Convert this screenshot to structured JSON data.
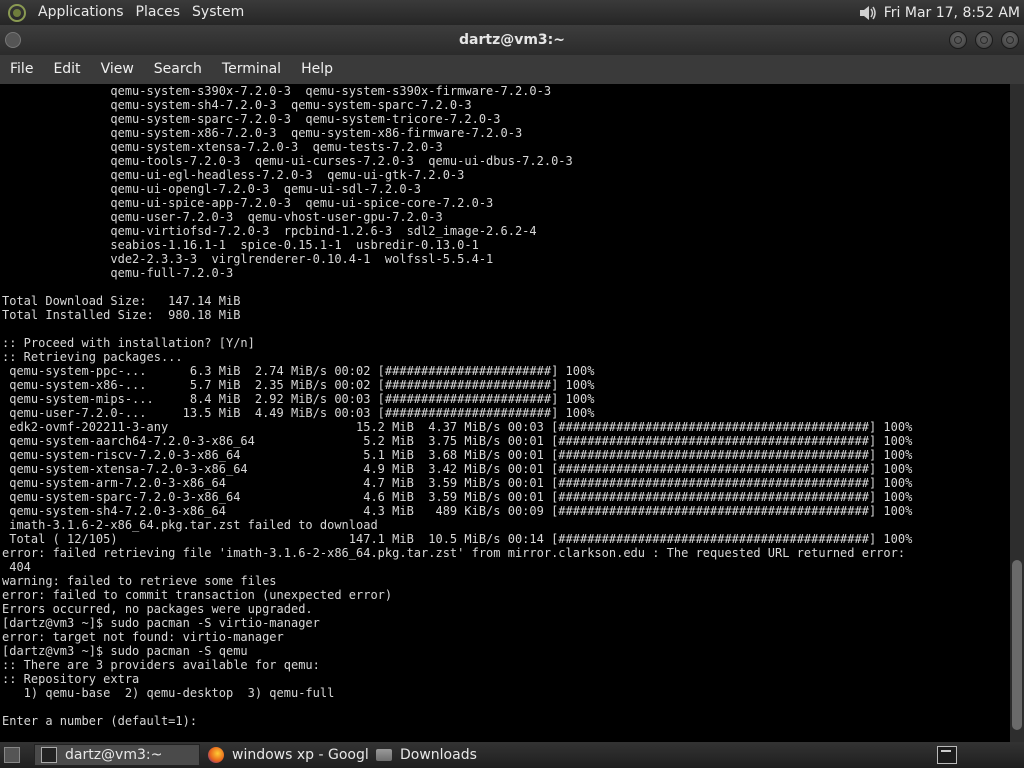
{
  "top_panel": {
    "menus": [
      "Applications",
      "Places",
      "System"
    ],
    "clock": "Fri Mar 17,  8:52 AM",
    "icons": {
      "logo": "distro-logo-icon",
      "volume": "speaker-volume-icon"
    }
  },
  "window": {
    "title": "dartz@vm3:~"
  },
  "menubar": [
    "File",
    "Edit",
    "View",
    "Search",
    "Terminal",
    "Help"
  ],
  "terminal": {
    "lines": [
      "               qemu-system-s390x-7.2.0-3  qemu-system-s390x-firmware-7.2.0-3",
      "               qemu-system-sh4-7.2.0-3  qemu-system-sparc-7.2.0-3",
      "               qemu-system-sparc-7.2.0-3  qemu-system-tricore-7.2.0-3",
      "               qemu-system-x86-7.2.0-3  qemu-system-x86-firmware-7.2.0-3",
      "               qemu-system-xtensa-7.2.0-3  qemu-tests-7.2.0-3",
      "               qemu-tools-7.2.0-3  qemu-ui-curses-7.2.0-3  qemu-ui-dbus-7.2.0-3",
      "               qemu-ui-egl-headless-7.2.0-3  qemu-ui-gtk-7.2.0-3",
      "               qemu-ui-opengl-7.2.0-3  qemu-ui-sdl-7.2.0-3",
      "               qemu-ui-spice-app-7.2.0-3  qemu-ui-spice-core-7.2.0-3",
      "               qemu-user-7.2.0-3  qemu-vhost-user-gpu-7.2.0-3",
      "               qemu-virtiofsd-7.2.0-3  rpcbind-1.2.6-3  sdl2_image-2.6.2-4",
      "               seabios-1.16.1-1  spice-0.15.1-1  usbredir-0.13.0-1",
      "               vde2-2.3.3-3  virglrenderer-0.10.4-1  wolfssl-5.5.4-1",
      "               qemu-full-7.2.0-3",
      "",
      "Total Download Size:   147.14 MiB",
      "Total Installed Size:  980.18 MiB",
      "",
      ":: Proceed with installation? [Y/n]",
      ":: Retrieving packages...",
      " qemu-system-ppc-...      6.3 MiB  2.74 MiB/s 00:02 [#######################] 100%",
      " qemu-system-x86-...      5.7 MiB  2.35 MiB/s 00:02 [#######################] 100%",
      " qemu-system-mips-...     8.4 MiB  2.92 MiB/s 00:03 [#######################] 100%",
      " qemu-user-7.2.0-...     13.5 MiB  4.49 MiB/s 00:03 [#######################] 100%",
      " edk2-ovmf-202211-3-any                          15.2 MiB  4.37 MiB/s 00:03 [###########################################] 100%",
      " qemu-system-aarch64-7.2.0-3-x86_64               5.2 MiB  3.75 MiB/s 00:01 [###########################################] 100%",
      " qemu-system-riscv-7.2.0-3-x86_64                 5.1 MiB  3.68 MiB/s 00:01 [###########################################] 100%",
      " qemu-system-xtensa-7.2.0-3-x86_64                4.9 MiB  3.42 MiB/s 00:01 [###########################################] 100%",
      " qemu-system-arm-7.2.0-3-x86_64                   4.7 MiB  3.59 MiB/s 00:01 [###########################################] 100%",
      " qemu-system-sparc-7.2.0-3-x86_64                 4.6 MiB  3.59 MiB/s 00:01 [###########################################] 100%",
      " qemu-system-sh4-7.2.0-3-x86_64                   4.3 MiB   489 KiB/s 00:09 [###########################################] 100%",
      " imath-3.1.6-2-x86_64.pkg.tar.zst failed to download",
      " Total ( 12/105)                                147.1 MiB  10.5 MiB/s 00:14 [###########################################] 100%",
      "error: failed retrieving file 'imath-3.1.6-2-x86_64.pkg.tar.zst' from mirror.clarkson.edu : The requested URL returned error:",
      " 404",
      "warning: failed to retrieve some files",
      "error: failed to commit transaction (unexpected error)",
      "Errors occurred, no packages were upgraded.",
      "[dartz@vm3 ~]$ sudo pacman -S virtio-manager",
      "error: target not found: virtio-manager",
      "[dartz@vm3 ~]$ sudo pacman -S qemu",
      ":: There are 3 providers available for qemu:",
      ":: Repository extra",
      "   1) qemu-base  2) qemu-desktop  3) qemu-full",
      "",
      "Enter a number (default=1): "
    ]
  },
  "taskbar": {
    "tasks": [
      {
        "label": "dartz@vm3:~",
        "icon": "terminal-icon",
        "active": true
      },
      {
        "label": "windows xp - Googl...",
        "icon": "firefox-icon",
        "active": false
      },
      {
        "label": "Downloads",
        "icon": "folder-icon",
        "active": false
      }
    ],
    "tray_icon": "terminal-icon"
  }
}
